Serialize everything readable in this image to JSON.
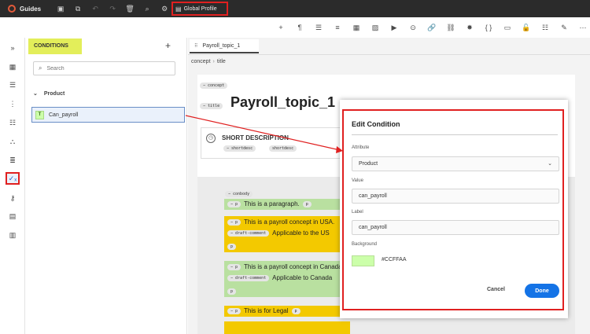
{
  "app": {
    "title": "Guides",
    "profile_label": "Global Profile"
  },
  "colors": {
    "accent": "#1473e6",
    "annotation": "#e02020",
    "highlight": "#e3ee5a",
    "condition_bg": "#CCFFAA",
    "yellow_block": "#f3c900"
  },
  "conditions_panel": {
    "title": "CONDITIONS",
    "search_placeholder": "Search",
    "group": "Product",
    "item_badge": "T",
    "item_label": "Can_payroll"
  },
  "editor": {
    "tab_label": "Payroll_topic_1",
    "breadcrumb": [
      "concept",
      "title"
    ],
    "tags": {
      "concept": "concept",
      "title": "title",
      "shortdesc": "shortdesc",
      "conbody": "conbody",
      "p": "p",
      "draft_comment": "draft-comment"
    },
    "doc_title": "Payroll_topic_1",
    "short_description": "SHORT DESCRIPTION",
    "paragraphs": [
      "This is a paragraph.",
      "This is a payroll concept in USA.",
      "Applicable to the US",
      "This is a payroll concept in Canada",
      "Applicable to Canada",
      "This is for Legal"
    ]
  },
  "dialog": {
    "title": "Edit Condition",
    "attribute_label": "Attribute",
    "attribute_value": "Product",
    "value_label": "Value",
    "value_value": "can_payroll",
    "label_label": "Label",
    "label_value": "can_payroll",
    "background_label": "Background",
    "background_hex": "#CCFFAA",
    "cancel_label": "Cancel",
    "done_label": "Done"
  }
}
